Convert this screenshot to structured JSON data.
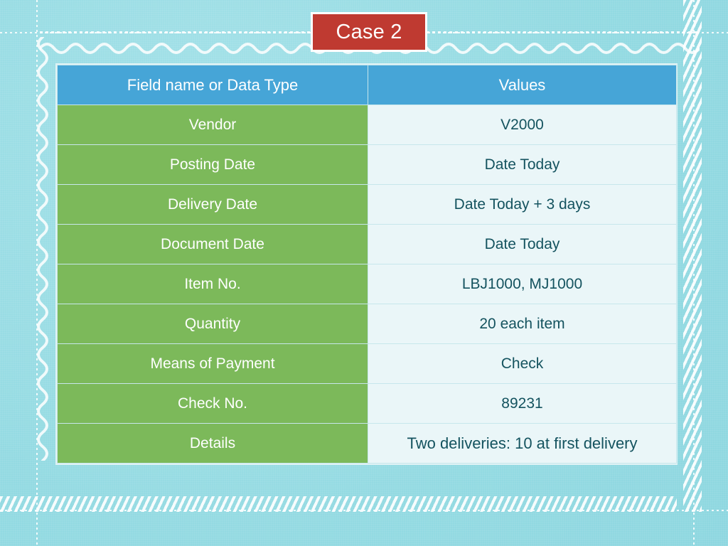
{
  "slide": {
    "title": "Case 2",
    "background_color": "#9adde4",
    "title_box_color": "#bf3a31",
    "title_text_color": "#ffffff"
  },
  "table": {
    "header_color": "#46a5d7",
    "field_color": "#7cb95a",
    "value_color": "#eaf6f8",
    "value_text_color": "#14535f",
    "columns": [
      "Field name or Data Type",
      "Values"
    ],
    "rows": [
      {
        "field": "Vendor",
        "value": "V2000"
      },
      {
        "field": "Posting Date",
        "value": "Date Today"
      },
      {
        "field": "Delivery Date",
        "value": "Date Today + 3 days"
      },
      {
        "field": "Document Date",
        "value": "Date Today"
      },
      {
        "field": "Item No.",
        "value": "LBJ1000, MJ1000"
      },
      {
        "field": "Quantity",
        "value": "20 each item"
      },
      {
        "field": "Means of Payment",
        "value": "Check"
      },
      {
        "field": "Check No.",
        "value": "89231"
      },
      {
        "field": "Details",
        "value": "Two deliveries: 10 at first delivery"
      }
    ]
  }
}
